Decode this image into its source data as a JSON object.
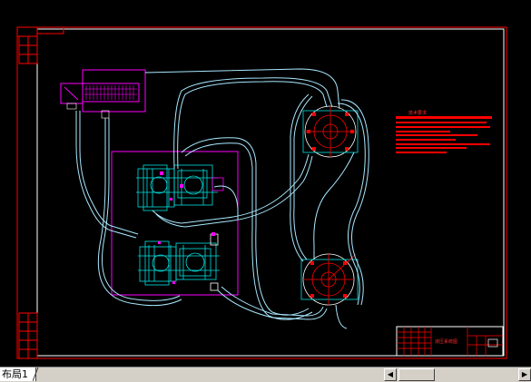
{
  "window": {
    "layout_tab": "布局1",
    "nav_icons": [
      "first-tab-arrow-icon",
      "prev-tab-arrow-icon",
      "next-tab-arrow-icon",
      "last-tab-arrow-icon"
    ],
    "scroll_left_glyph": "◀",
    "scroll_right_glyph": "▶",
    "nav_glyphs": [
      "|◀",
      "◀",
      "▶",
      "▶|"
    ]
  },
  "drawing": {
    "notes_title": "技术要求",
    "titleblock_name": "液压系统图",
    "colors": {
      "background": "#000000",
      "frame": "#ff0000",
      "hydraulic_lines": "#a8e8ff",
      "components": "#00e0e0",
      "viewport": "#ff00ff",
      "annotation_text": "#ff2a2a"
    }
  }
}
